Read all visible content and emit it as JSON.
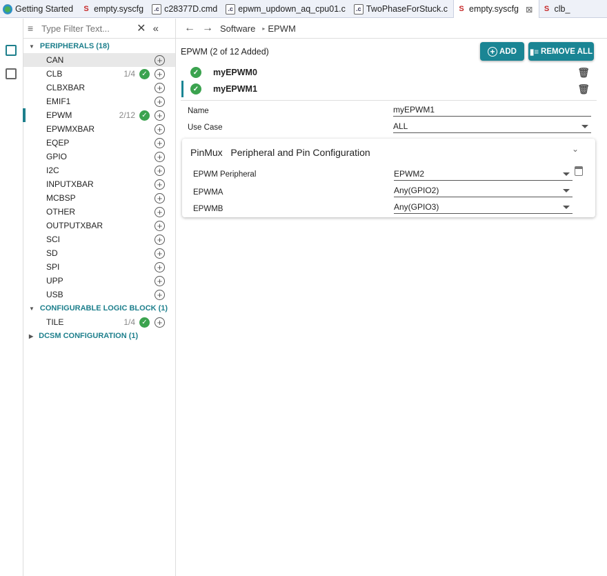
{
  "tabs": [
    {
      "label": "Getting Started",
      "icon": "getting-started-icon"
    },
    {
      "label": "empty.syscfg",
      "icon": "syscfg-icon"
    },
    {
      "label": "c28377D.cmd",
      "icon": "c-file-icon"
    },
    {
      "label": "epwm_updown_aq_cpu01.c",
      "icon": "c-file-icon"
    },
    {
      "label": "TwoPhaseForStuck.c",
      "icon": "c-file-icon"
    },
    {
      "label": "empty.syscfg",
      "icon": "syscfg-icon",
      "active": true
    },
    {
      "label": "clb_",
      "icon": "syscfg-icon"
    }
  ],
  "filter": {
    "placeholder": "Type Filter Text..."
  },
  "tree": {
    "peripherals_header": "PERIPHERALS (18)",
    "peripherals": [
      {
        "label": "CAN"
      },
      {
        "label": "CLB",
        "count": "1/4"
      },
      {
        "label": "CLBXBAR"
      },
      {
        "label": "EMIF1"
      },
      {
        "label": "EPWM",
        "count": "2/12"
      },
      {
        "label": "EPWMXBAR"
      },
      {
        "label": "EQEP"
      },
      {
        "label": "GPIO"
      },
      {
        "label": "I2C"
      },
      {
        "label": "INPUTXBAR"
      },
      {
        "label": "MCBSP"
      },
      {
        "label": "OTHER"
      },
      {
        "label": "OUTPUTXBAR"
      },
      {
        "label": "SCI"
      },
      {
        "label": "SD"
      },
      {
        "label": "SPI"
      },
      {
        "label": "UPP"
      },
      {
        "label": "USB"
      }
    ],
    "clb_header": "CONFIGURABLE LOGIC BLOCK (1)",
    "clb_items": [
      {
        "label": "TILE",
        "count": "1/4"
      }
    ],
    "dcsm_header": "DCSM CONFIGURATION (1)"
  },
  "breadcrumb": {
    "items": [
      "Software",
      "EPWM"
    ]
  },
  "main": {
    "title": "EPWM (2 of 12 Added)",
    "add_label": "ADD",
    "remove_all_label": "REMOVE ALL",
    "instances": [
      "myEPWM0",
      "myEPWM1"
    ],
    "name_label": "Name",
    "name_value": "myEPWM1",
    "usecase_label": "Use Case",
    "usecase_value": "ALL",
    "pinmux": {
      "title": "PinMux",
      "subtitle": "Peripheral and Pin Configuration",
      "fields": [
        {
          "label": "EPWM Peripheral",
          "value": "EPWM2"
        },
        {
          "label": "EPWMA",
          "value": "Any(GPIO2)"
        },
        {
          "label": "EPWMB",
          "value": "Any(GPIO3)"
        }
      ]
    }
  },
  "colors": {
    "accent": "#1a8594",
    "ok": "#3ba34f"
  }
}
